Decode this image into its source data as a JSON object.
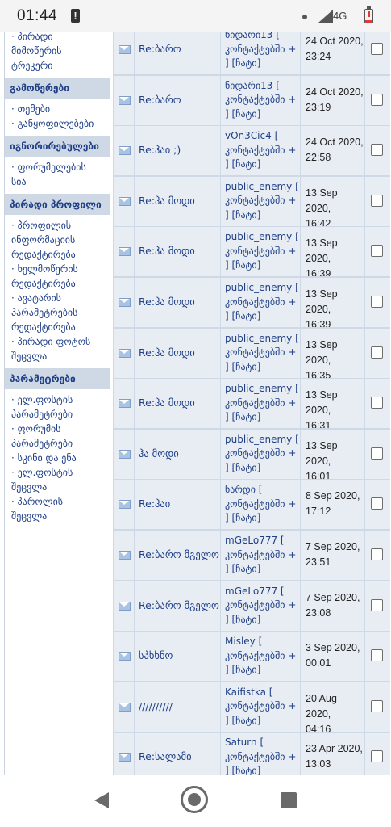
{
  "status_bar": {
    "time": "01:44",
    "network": "4G"
  },
  "sidebar": {
    "top_lines": [
      "· პირადი",
      "მიმოწერის",
      "ტრეკერი"
    ],
    "sections": [
      {
        "title": "გამოწერები",
        "items": [
          "· თემები",
          "· განყოფილებები"
        ]
      },
      {
        "title": "იგნორირებულები",
        "items": [
          "· ფორუმელების",
          "სია"
        ]
      },
      {
        "title": "პირადი პროფილი",
        "items": [
          "· პროფილის",
          "ინფორმაციის",
          "რედაქტირება",
          "· ხელმოწერის",
          "რედაქტირება",
          "· ავატარის",
          "პარამეტრების",
          "რედაქტირება",
          "· პირადი ფოტოს",
          "შეცვლა"
        ]
      },
      {
        "title": "პარამეტრები",
        "items": [
          "· ელ.ფოსტის",
          "პარამეტრები",
          "· ფორუმის",
          "პარამეტრები",
          "· სკინი და ენა",
          "· ელ.ფოსტის",
          "შეცვლა",
          "· პაროლის",
          "შეცვლა"
        ]
      }
    ]
  },
  "messages": [
    {
      "subject": "Re:ბარო",
      "author": "ნიდარი13",
      "contacts": "[ კონტაქტებში + ] [ჩატი]",
      "date": "24 Oct 2020,",
      "time": "23:24"
    },
    {
      "subject": "Re:ბარო",
      "author": "ნიდარი13",
      "contacts": "[ კონტაქტებში + ] [ჩატი]",
      "date": "24 Oct 2020,",
      "time": "23:19"
    },
    {
      "subject": "Re:ჰაი ;)",
      "author": "vOn3Cic4",
      "contacts": "[ კონტაქტებში + ] [ჩატი]",
      "date": "24 Oct 2020,",
      "time": "22:58"
    },
    {
      "subject": "Re:ჰა მოდი",
      "author": "public_enemy",
      "contacts": "[ კონტაქტებში + ] [ჩატი]",
      "date": "13 Sep 2020,",
      "time": "16:42"
    },
    {
      "subject": "Re:ჰა მოდი",
      "author": "public_enemy",
      "contacts": "[ კონტაქტებში + ] [ჩატი]",
      "date": "13 Sep 2020,",
      "time": "16:39"
    },
    {
      "subject": "Re:ჰა მოდი",
      "author": "public_enemy",
      "contacts": "[ კონტაქტებში + ] [ჩატი]",
      "date": "13 Sep 2020,",
      "time": "16:39"
    },
    {
      "subject": "Re:ჰა მოდი",
      "author": "public_enemy",
      "contacts": "[ კონტაქტებში + ] [ჩატი]",
      "date": "13 Sep 2020,",
      "time": "16:35"
    },
    {
      "subject": "Re:ჰა მოდი",
      "author": "public_enemy",
      "contacts": "[ კონტაქტებში + ] [ჩატი]",
      "date": "13 Sep 2020,",
      "time": "16:31"
    },
    {
      "subject": "ჰა მოდი",
      "author": "public_enemy",
      "contacts": "[ კონტაქტებში + ] [ჩატი]",
      "date": "13 Sep 2020,",
      "time": "16:01"
    },
    {
      "subject": "Re:ჰაი",
      "author": "ნარდი",
      "contacts": "[ კონტაქტებში + ] [ჩატი]",
      "date": "8 Sep 2020,",
      "time": "17:12"
    },
    {
      "subject": "Re:ბარო მგელო",
      "author": "mGeLo777",
      "contacts": "[ კონტაქტებში + ] [ჩატი]",
      "date": "7 Sep 2020,",
      "time": "23:51"
    },
    {
      "subject": "Re:ბარო მგელო",
      "author": "mGeLo777",
      "contacts": "[ კონტაქტებში + ] [ჩატი]",
      "date": "7 Sep 2020,",
      "time": "23:08"
    },
    {
      "subject": "სპხხნო",
      "author": "Misley",
      "contacts": "[ კონტაქტებში + ] [ჩატი]",
      "date": "3 Sep 2020,",
      "time": "00:01"
    },
    {
      "subject": "//////////",
      "author": "Kaifistka",
      "contacts": "[ კონტაქტებში + ] [ჩატი]",
      "date": "20 Aug 2020,",
      "time": "04:16"
    },
    {
      "subject": "Re:სალამი",
      "author": "Saturn",
      "contacts": "[ კონტაქტებში + ] [ჩატი]",
      "date": "23 Apr 2020,",
      "time": "13:03"
    }
  ]
}
